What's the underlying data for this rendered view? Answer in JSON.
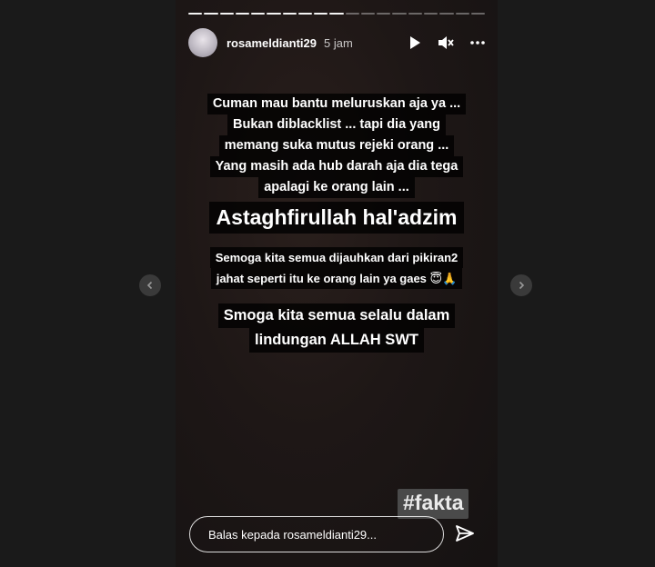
{
  "header": {
    "username": "rosameldianti29",
    "time": "5 jam"
  },
  "progress": {
    "segments_total": 19,
    "segments_viewed": 10
  },
  "story": {
    "block1": [
      "Cuman mau bantu meluruskan aja ya ...",
      "Bukan diblacklist ... tapi dia yang",
      "memang suka mutus rejeki orang ...",
      "Yang masih ada hub darah aja dia tega",
      "apalagi ke orang lain ..."
    ],
    "block2": "Astaghfirullah hal'adzim",
    "block3": [
      "Semoga kita semua dijauhkan dari pikiran2",
      "jahat seperti itu ke orang lain ya gaes 😇🙏"
    ],
    "block4": [
      "Smoga kita semua selalu dalam",
      "lindungan ALLAH SWT"
    ],
    "hashtag": "#fakta"
  },
  "reply": {
    "placeholder": "Balas kepada rosameldianti29..."
  },
  "icons": {
    "play": "play-icon",
    "mute": "mute-icon",
    "more": "more-icon",
    "send": "send-icon",
    "prev": "chevron-left-icon",
    "next": "chevron-right-icon"
  }
}
